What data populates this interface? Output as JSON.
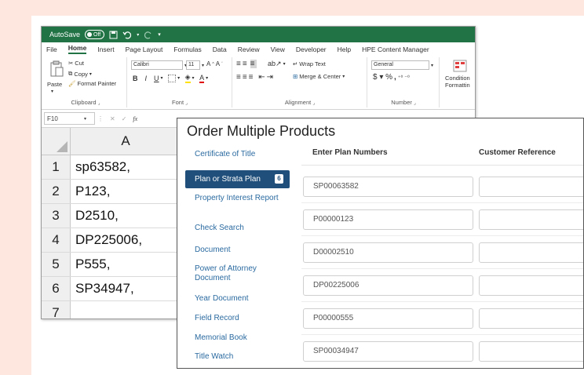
{
  "excel": {
    "title_bar": {
      "autosave": "AutoSave",
      "autosave_state": "Off"
    },
    "menu": [
      "File",
      "Home",
      "Insert",
      "Page Layout",
      "Formulas",
      "Data",
      "Review",
      "View",
      "Developer",
      "Help",
      "HPE Content Manager"
    ],
    "ribbon": {
      "paste": "Paste",
      "cut": "Cut",
      "copy": "Copy",
      "format_painter": "Format Painter",
      "clipboard": "Clipboard",
      "font_name": "Calibri",
      "font_size": "11",
      "font": "Font",
      "wrap_text": "Wrap Text",
      "merge_center": "Merge & Center",
      "alignment": "Alignment",
      "number_format": "General",
      "number": "Number",
      "conditional_1": "Condition",
      "conditional_2": "Formattin"
    },
    "name_box": "F10",
    "fx": "fx",
    "column_header": "A",
    "rows": [
      {
        "num": "1",
        "value": "sp63582,"
      },
      {
        "num": "2",
        "value": "P123,"
      },
      {
        "num": "3",
        "value": "D2510,"
      },
      {
        "num": "4",
        "value": "DP225006,"
      },
      {
        "num": "5",
        "value": "P555,"
      },
      {
        "num": "6",
        "value": "SP34947,"
      },
      {
        "num": "7",
        "value": ""
      }
    ]
  },
  "order": {
    "title": "Order Multiple Products",
    "sidebar": [
      {
        "label": "Certificate of Title"
      },
      {
        "label": "Plan or Strata Plan",
        "badge": "6",
        "active": true
      },
      {
        "label": "Property Interest Report"
      },
      {
        "label": "Check Search"
      },
      {
        "label": "Document"
      },
      {
        "label": "Power of Attorney Document"
      },
      {
        "label": "Year Document"
      },
      {
        "label": "Field Record"
      },
      {
        "label": "Memorial Book"
      },
      {
        "label": "Title Watch"
      }
    ],
    "columns": {
      "plan_numbers": "Enter Plan Numbers",
      "customer_reference": "Customer Reference"
    },
    "plan_numbers": [
      "SP00063582",
      "P00000123",
      "D00002510",
      "DP00225006",
      "P00000555",
      "SP00034947"
    ]
  },
  "colors": {
    "excel_green": "#217346",
    "sidebar_active": "#1f4f7a",
    "link": "#2a6aa0",
    "backdrop": "#fde7df"
  }
}
